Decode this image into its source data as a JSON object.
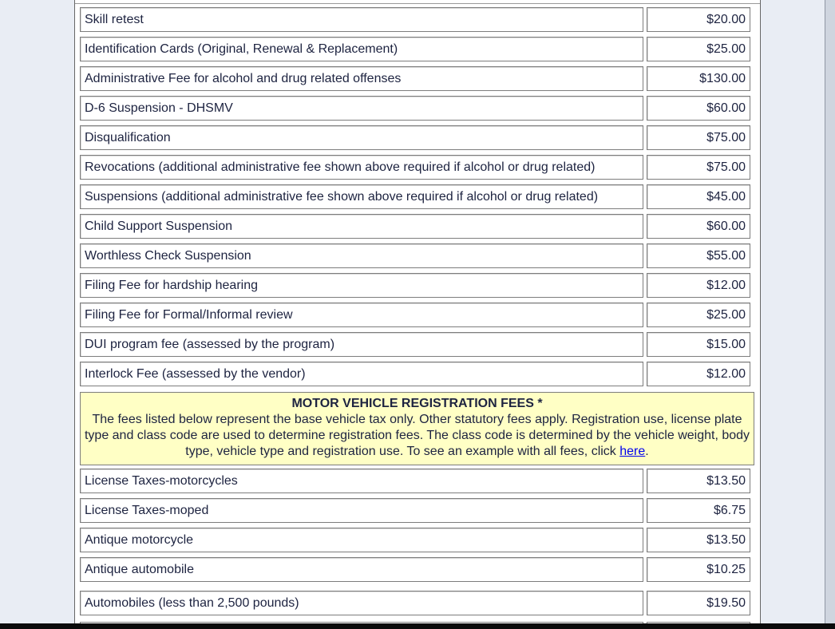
{
  "fees_table": {
    "rows_top": [
      {
        "label": "Skill retest",
        "fee": "$20.00"
      },
      {
        "label": "Identification Cards (Original, Renewal & Replacement)",
        "fee": "$25.00"
      },
      {
        "label": "Administrative Fee for alcohol and drug related offenses",
        "fee": "$130.00"
      },
      {
        "label": "D-6 Suspension - DHSMV",
        "fee": "$60.00"
      },
      {
        "label": "Disqualification",
        "fee": "$75.00"
      },
      {
        "label": "Revocations (additional administrative fee shown above required if alcohol or drug related)",
        "fee": "$75.00"
      },
      {
        "label": "Suspensions (additional administrative fee shown above required if alcohol or drug related)",
        "fee": "$45.00"
      },
      {
        "label": "Child Support Suspension",
        "fee": "$60.00"
      },
      {
        "label": "Worthless Check Suspension",
        "fee": "$55.00"
      },
      {
        "label": "Filing Fee for hardship hearing",
        "fee": "$12.00"
      },
      {
        "label": "Filing Fee for Formal/Informal review",
        "fee": "$25.00"
      },
      {
        "label": "DUI program fee (assessed by the program)",
        "fee": "$15.00"
      },
      {
        "label": "Interlock Fee (assessed by the vendor)",
        "fee": "$12.00"
      }
    ],
    "registration_banner": {
      "title": "MOTOR VEHICLE REGISTRATION FEES *",
      "text_before_link": "The fees listed below represent the base vehicle tax only. Other statutory fees apply. Registration use, license plate type and class code are used to determine registration fees. The class code is determined by the vehicle weight, body type, vehicle type and registration use. To see an example with all fees, click ",
      "link_text": "here",
      "text_after_link": "."
    },
    "rows_bottom": [
      {
        "label": "License Taxes-motorcycles",
        "fee": "$13.50"
      },
      {
        "label": "License Taxes-moped",
        "fee": "$6.75"
      },
      {
        "label": "Antique motorcycle",
        "fee": "$13.50"
      },
      {
        "label": "Antique automobile",
        "fee": "$10.25"
      },
      {
        "label": "Automobiles (less than 2,500 pounds)",
        "fee": "$19.50"
      }
    ]
  }
}
